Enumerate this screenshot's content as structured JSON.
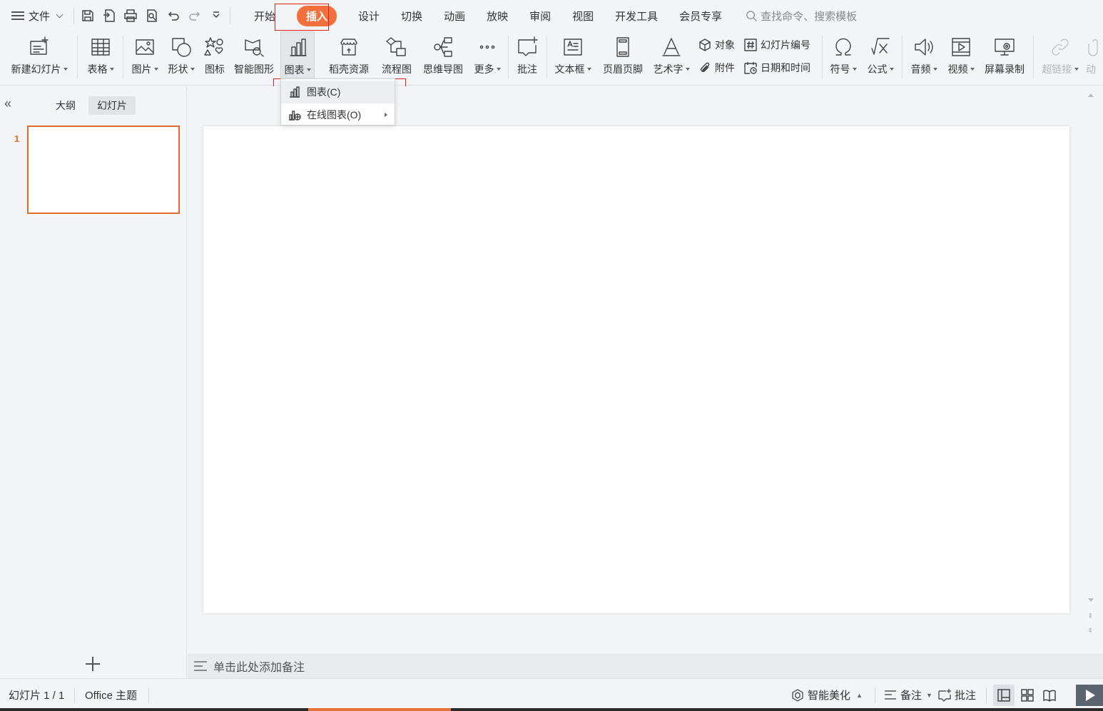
{
  "menu": {
    "file_label": "文件",
    "tabs": [
      "开始",
      "插入",
      "设计",
      "切换",
      "动画",
      "放映",
      "审阅",
      "视图",
      "开发工具",
      "会员专享"
    ],
    "active_tab": "插入",
    "search_placeholder": "查找命令、搜索模板"
  },
  "ribbon": {
    "new_slide": "新建幻灯片",
    "table": "表格",
    "picture": "图片",
    "shape": "形状",
    "icon": "图标",
    "smart_art": "智能图形",
    "chart": "图表",
    "docer": "稻壳资源",
    "flowchart": "流程图",
    "mindmap": "思维导图",
    "more": "更多",
    "comment": "批注",
    "textbox": "文本框",
    "header_footer": "页眉页脚",
    "wordart": "艺术字",
    "object": "对象",
    "attachment": "附件",
    "slide_number": "幻灯片编号",
    "date_time": "日期和时间",
    "symbol": "符号",
    "formula": "公式",
    "audio": "音频",
    "video": "视频",
    "screen_record": "屏幕录制",
    "hyperlink": "超链接",
    "action": "动"
  },
  "chart_menu": {
    "items": [
      {
        "label": "图表(C)",
        "icon": "bar-chart-icon"
      },
      {
        "label": "在线图表(O)",
        "icon": "online-chart-icon"
      }
    ]
  },
  "left_panel": {
    "collapse_glyph": "«",
    "tab_outline": "大纲",
    "tab_slides": "幻灯片",
    "slide_number": "1"
  },
  "notes_placeholder": "单击此处添加备注",
  "status": {
    "slide_info": "幻灯片 1 / 1",
    "theme": "Office 主题",
    "beautify": "智能美化",
    "notes": "备注",
    "comments": "批注"
  },
  "colors": {
    "accent": "#f2703d",
    "highlight_box": "#e02020",
    "thumb_border": "#e06b2a"
  }
}
